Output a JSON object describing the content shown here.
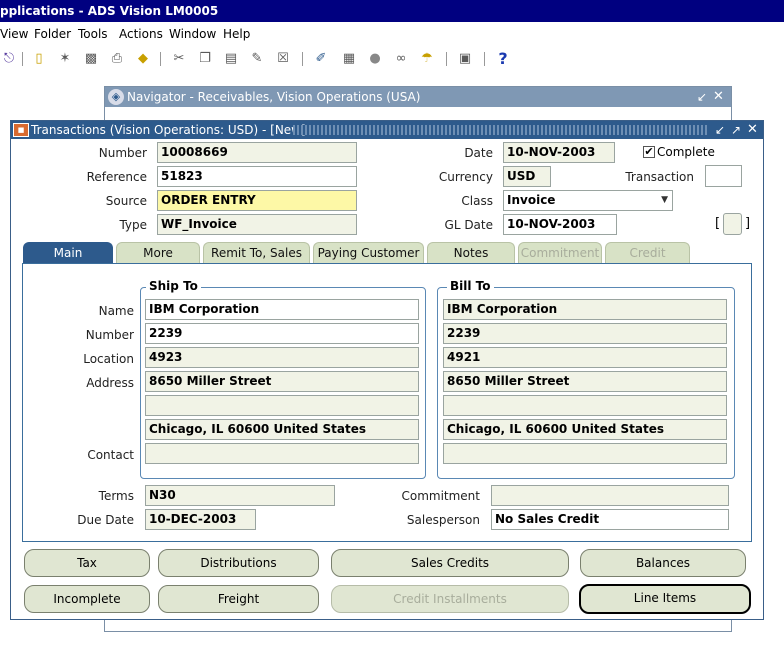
{
  "app": {
    "title": "pplications - ADS Vision LM0005"
  },
  "menu": [
    "View",
    "Folder",
    "Tools",
    "Actions",
    "Window",
    "Help"
  ],
  "toolbar_icons": [
    "exit-icon",
    "open-folder-icon",
    "navigator-icon",
    "save-icon",
    "print-icon",
    "zoom-icon",
    "cut-icon",
    "copy-icon",
    "paste-icon",
    "clear-record-icon",
    "delete-record-icon",
    "edit-icon",
    "attachments-list-icon",
    "folder-tools-icon",
    "translations-icon",
    "attachment-icon",
    "zoom-in-icon",
    "help-icon"
  ],
  "navigator": {
    "title": "Navigator - Receivables, Vision Operations (USA)"
  },
  "transactions": {
    "title": "Transactions (Vision Operations: USD) - [New]",
    "labels": {
      "number": "Number",
      "reference": "Reference",
      "source": "Source",
      "type": "Type",
      "date": "Date",
      "currency": "Currency",
      "class": "Class",
      "gl_date": "GL Date",
      "complete": "Complete",
      "transaction": "Transaction"
    },
    "values": {
      "number": "10008669",
      "reference": "51823",
      "source": "ORDER ENTRY",
      "type": "WF_Invoice",
      "date": "10-NOV-2003",
      "currency": "USD",
      "class": "Invoice",
      "gl_date": "10-NOV-2003",
      "bracket_left": "[",
      "bracket_right": "]"
    }
  },
  "tabs": [
    {
      "label": "Main",
      "state": "active"
    },
    {
      "label": "More",
      "state": "normal"
    },
    {
      "label": "Remit To, Sales",
      "state": "normal"
    },
    {
      "label": "Paying Customer",
      "state": "normal"
    },
    {
      "label": "Notes",
      "state": "normal"
    },
    {
      "label": "Commitment",
      "state": "disabled"
    },
    {
      "label": "Credit",
      "state": "disabled"
    }
  ],
  "main": {
    "labels": {
      "name": "Name",
      "number": "Number",
      "location": "Location",
      "address": "Address",
      "contact": "Contact",
      "terms": "Terms",
      "due_date": "Due Date",
      "commitment": "Commitment",
      "salesperson": "Salesperson"
    },
    "ship_to": {
      "title": "Ship To",
      "name": "IBM Corporation",
      "number": "2239",
      "location": "4923",
      "address1": "8650 Miller Street",
      "address2": "",
      "address3": "Chicago, IL 60600 United States",
      "contact": ""
    },
    "bill_to": {
      "title": "Bill To",
      "name": "IBM Corporation",
      "number": "2239",
      "location": "4921",
      "address1": "8650 Miller Street",
      "address2": "",
      "address3": "Chicago, IL 60600 United States",
      "contact": ""
    },
    "terms": "N30",
    "due_date": "10-DEC-2003",
    "commitment": "",
    "salesperson": "No Sales Credit"
  },
  "buttons": {
    "tax": "Tax",
    "distributions": "Distributions",
    "sales_credits": "Sales Credits",
    "balances": "Balances",
    "incomplete": "Incomplete",
    "freight": "Freight",
    "credit_installments": "Credit Installments",
    "line_items": "Line Items"
  },
  "colors": {
    "title_bar": "#000080",
    "window_title": "#2d5a8c",
    "field_bg": "#f1f3e6",
    "required_bg": "#fdf8a6",
    "tab_bg": "#d8e2c6"
  }
}
